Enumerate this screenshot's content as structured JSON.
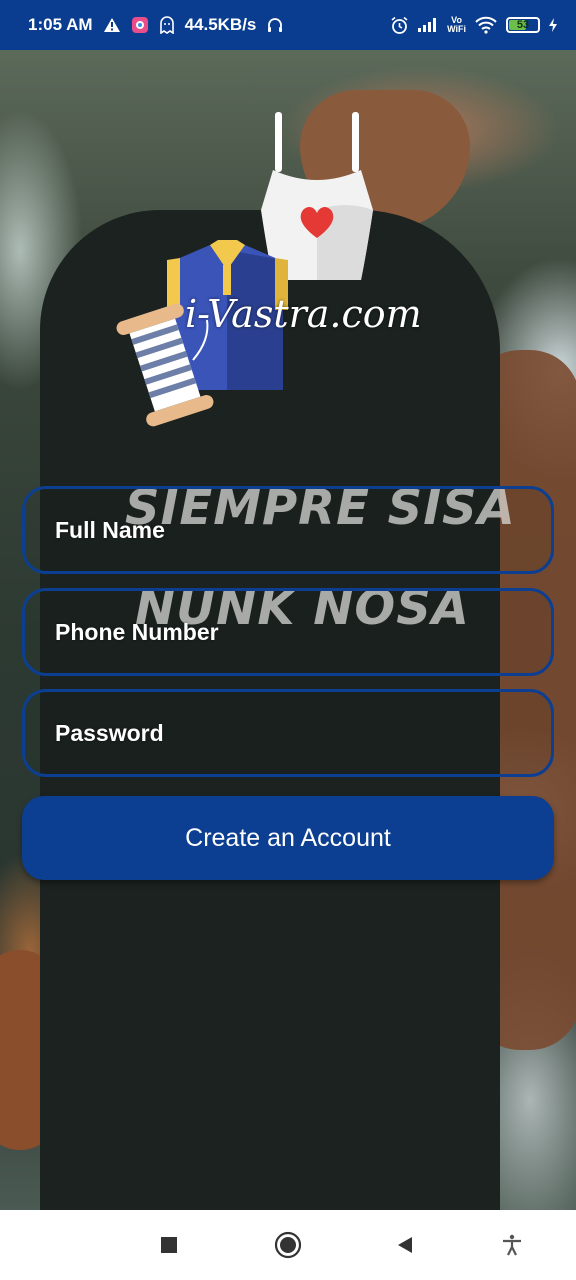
{
  "status_bar": {
    "time": "1:05 AM",
    "network_speed": "44.5KB/s",
    "vowifi_top": "Vo",
    "vowifi_bottom": "WiFi",
    "battery": "53",
    "icons": [
      "warning-icon",
      "app-icon",
      "ghost-icon",
      "headset-icon",
      "alarm-icon",
      "signal-icon",
      "vowifi-icon",
      "wifi-icon",
      "battery-icon",
      "charging-icon"
    ]
  },
  "logo": {
    "text": "i-Vastra.com",
    "icons": [
      "dress-icon",
      "shirt-icon",
      "thread-spool-icon",
      "heart-icon"
    ]
  },
  "background": {
    "print_line1": "SIEMPRE SISA",
    "print_line2": "NUNK NOSA"
  },
  "form": {
    "full_name_label": "Full Name",
    "phone_label": "Phone Number",
    "password_label": "Password",
    "submit_label": "Create an Account"
  },
  "nav_bar": {
    "icons": [
      "recents-icon",
      "home-icon",
      "back-icon",
      "accessibility-icon"
    ]
  },
  "colors": {
    "primary": "#0c3f91",
    "status_bar": "#0a3d8f",
    "text_on_primary": "#ffffff"
  }
}
